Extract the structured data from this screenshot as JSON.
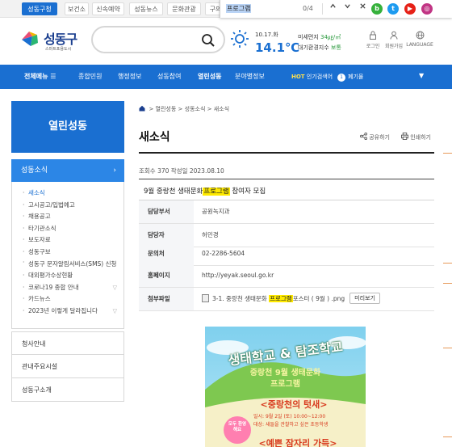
{
  "topbar": {
    "tabs": [
      "성동구청",
      "보건소",
      "신속예약",
      "성동뉴스",
      "문화관광",
      "구의"
    ]
  },
  "findbar": {
    "term": "프로그램",
    "count": "0/4"
  },
  "colors": {
    "primary": "#1a6fd1",
    "highlight": "#ffea00"
  },
  "header": {
    "logo_name": "성동구",
    "logo_sub": "스마트포용도시",
    "search_placeholder": "",
    "date": "10.17.화",
    "temperature": "14.1℃",
    "air_label": "미세먼지",
    "air_value": "34㎍/㎥",
    "env_label": "대기환경지수",
    "env_value": "보통",
    "login": "로그인",
    "join": "회원가입",
    "language": "LANGUAGE"
  },
  "gnb": {
    "all_menu": "전체메뉴",
    "items": [
      "종합민원",
      "행정정보",
      "성동참여",
      "열린성동",
      "분야별정보"
    ],
    "hot_label": "HOT",
    "hot_text": "인기검색어",
    "hot_rank": "1",
    "hot_keyword": "폐기물"
  },
  "sidebar": {
    "title": "열린성동",
    "sub_title": "성동소식",
    "items": [
      "새소식",
      "고시공고/입법예고",
      "채용공고",
      "타기관소식",
      "보도자료",
      "성동구보",
      "성동구 문자알림서비스(SMS) 신청",
      "대외평가수상현황",
      "코로나19 종합 안내",
      "카드뉴스",
      "2023년 이렇게 달라집니다"
    ],
    "menus": [
      "청사안내",
      "관내주요시설",
      "성동구소개"
    ]
  },
  "content": {
    "breadcrumb": [
      "열린성동",
      "성동소식",
      "새소식"
    ],
    "page_title": "새소식",
    "share": "공유하기",
    "print": "인쇄하기",
    "meta": "조회수 370 작성일 2023.08.10",
    "post_title_pre": "9월 중랑천 생태문화",
    "post_title_hl": "프로그램",
    "post_title_post": " 참여자 모집",
    "rows": [
      {
        "label": "담당부서",
        "value": "공원녹지과"
      },
      {
        "label": "담당자",
        "value": "허민경"
      },
      {
        "label": "문의처",
        "value": "02-2286-5604"
      },
      {
        "label": "홈페이지",
        "value": "http://yeyak.seoul.go.kr"
      }
    ],
    "file_label": "첨부파일",
    "file_pre": "3-1. 중랑천 생태문화 ",
    "file_hl": "프로그램",
    "file_post": "포스터 ( 9월 ) .png",
    "preview": "미리보기"
  },
  "poster": {
    "line1": "생태학교 & 탐조학교",
    "line2": "중랑천 9월 생태문화",
    "line3": "프로그램",
    "line4": "<중랑천의 텃새>",
    "line5": "일시: 9월 2일 (토) 10:00~12:00",
    "line6": "대상: 새들을 관찰하고 싶은 초등학생",
    "badge": "모두 환영해요",
    "line7": "<예쁜 잠자리 가득>"
  }
}
